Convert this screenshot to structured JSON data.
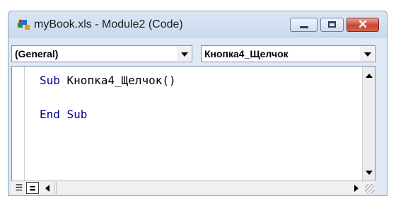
{
  "window": {
    "title": "myBook.xls - Module2 (Code)",
    "icon": "vba-module-icon",
    "controls": {
      "minimize": "minimize-icon",
      "maximize": "maximize-icon",
      "close": "✕"
    }
  },
  "object_combo": {
    "selected": "(General)"
  },
  "procedure_combo": {
    "selected": "Кнопка4_Щелчок"
  },
  "code": {
    "lines": [
      {
        "kw": "Sub",
        "rest": " Кнопка4_Щелчок()"
      },
      {
        "kw": "End Sub",
        "rest": ""
      }
    ]
  },
  "colors": {
    "keyword": "#00008b",
    "close_button": "#c74533",
    "frame": "#dfe9f6"
  }
}
